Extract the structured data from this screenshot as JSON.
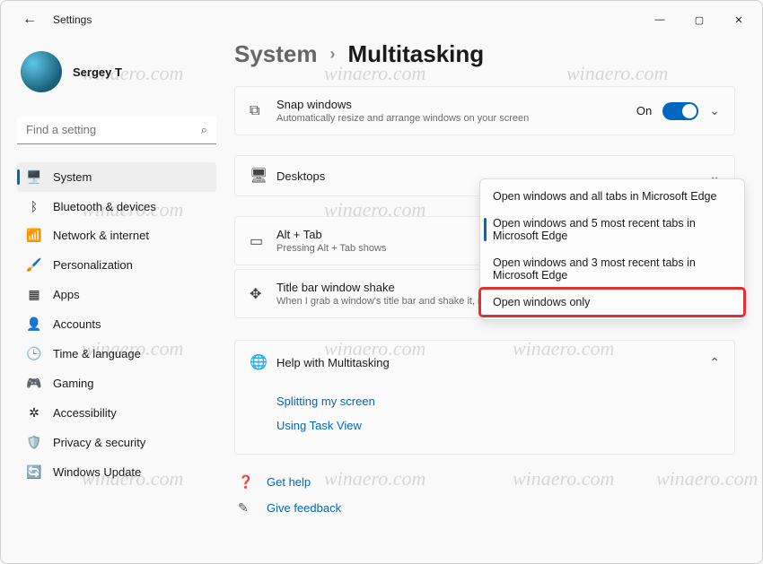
{
  "app_title": "Settings",
  "user": {
    "name": "Sergey T"
  },
  "search": {
    "placeholder": "Find a setting"
  },
  "sidebar": {
    "items": [
      {
        "icon": "🖥️",
        "label": "System",
        "active": true
      },
      {
        "icon": "ᛒ",
        "label": "Bluetooth & devices"
      },
      {
        "icon": "📶",
        "label": "Network & internet"
      },
      {
        "icon": "🖌️",
        "label": "Personalization"
      },
      {
        "icon": "▦",
        "label": "Apps"
      },
      {
        "icon": "👤",
        "label": "Accounts"
      },
      {
        "icon": "🕒",
        "label": "Time & language"
      },
      {
        "icon": "🎮",
        "label": "Gaming"
      },
      {
        "icon": "✲",
        "label": "Accessibility"
      },
      {
        "icon": "🛡️",
        "label": "Privacy & security"
      },
      {
        "icon": "🔄",
        "label": "Windows Update"
      }
    ]
  },
  "breadcrumb": {
    "parent": "System",
    "current": "Multitasking"
  },
  "cards": {
    "snap": {
      "title": "Snap windows",
      "sub": "Automatically resize and arrange windows on your screen",
      "state": "On"
    },
    "desktops": {
      "title": "Desktops"
    },
    "alttab": {
      "title": "Alt + Tab",
      "sub": "Pressing Alt + Tab shows"
    },
    "shake": {
      "title": "Title bar window shake",
      "sub": "When I grab a window's title bar and shake it, min"
    }
  },
  "dropdown": {
    "options": [
      "Open windows and all tabs in Microsoft Edge",
      "Open windows and 5 most recent tabs in Microsoft Edge",
      "Open windows and 3 most recent tabs in Microsoft Edge",
      "Open windows only"
    ],
    "selected_index": 1,
    "highlight_index": 3
  },
  "help": {
    "title": "Help with Multitasking",
    "links": [
      "Splitting my screen",
      "Using Task View"
    ]
  },
  "footer": {
    "get_help": "Get help",
    "feedback": "Give feedback"
  },
  "watermark": "winaero.com"
}
